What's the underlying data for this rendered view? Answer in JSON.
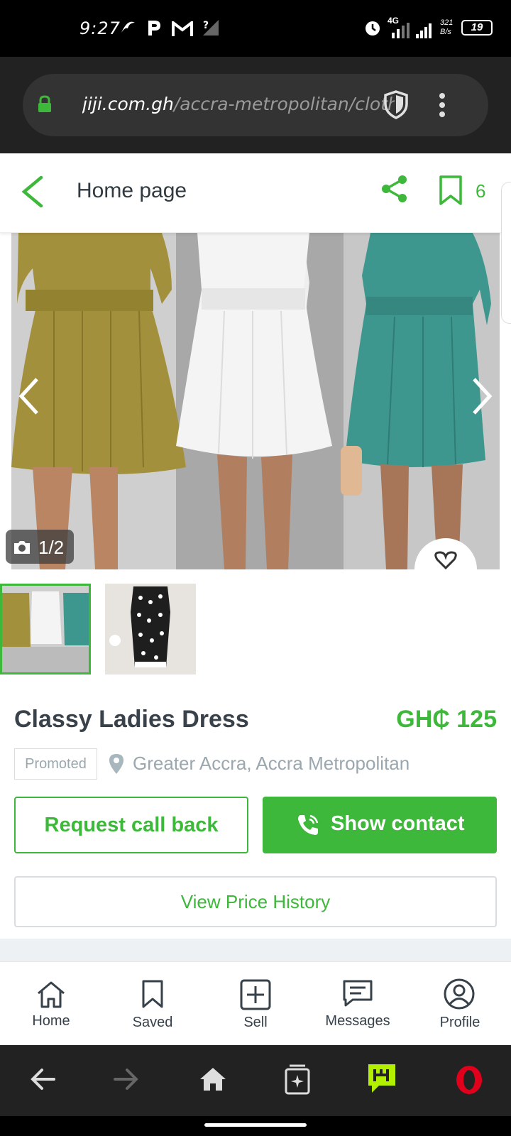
{
  "status_bar": {
    "time": "9:27",
    "battery": "19",
    "data_speed": "321 B/s",
    "network": "4G"
  },
  "browser": {
    "url_domain": "jiji.com.gh",
    "url_path": "/accra-metropolitan/clothing"
  },
  "header": {
    "title": "Home page",
    "saved_count": "6"
  },
  "gallery": {
    "counter": "1/2"
  },
  "product": {
    "title": "Classy Ladies Dress",
    "price": "GH₵ 125",
    "badge": "Promoted",
    "location": "Greater Accra, Accra Metropolitan"
  },
  "actions": {
    "request_call_back": "Request call back",
    "show_contact": "Show contact",
    "view_price_history": "View Price History"
  },
  "bottom_nav": {
    "items": [
      {
        "label": "Home",
        "icon": "home-icon"
      },
      {
        "label": "Saved",
        "icon": "bookmark-icon"
      },
      {
        "label": "Sell",
        "icon": "plus-box-icon"
      },
      {
        "label": "Messages",
        "icon": "message-icon"
      },
      {
        "label": "Profile",
        "icon": "profile-icon"
      }
    ]
  },
  "colors": {
    "brand_green": "#3db83a",
    "text_dark": "#39424a",
    "text_muted": "#9aa7ae"
  }
}
